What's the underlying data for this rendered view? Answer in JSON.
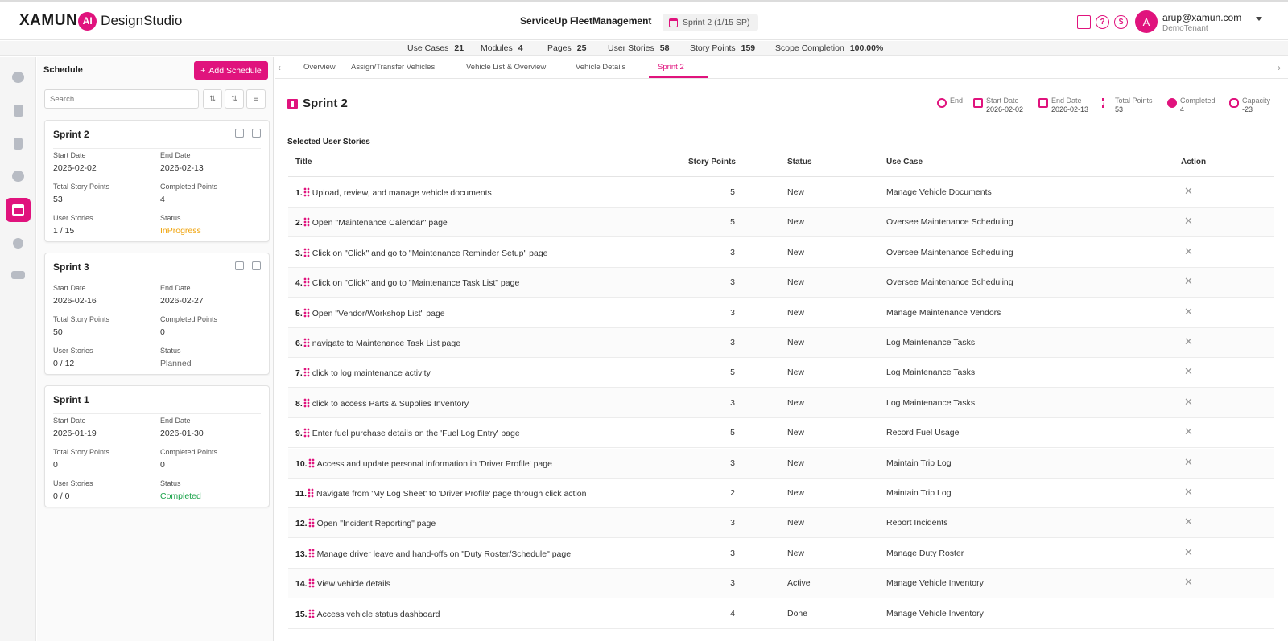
{
  "header": {
    "logo_text": "XAMUN",
    "logo_ai": "AI",
    "logo_suffix": "DesignStudio",
    "project_name": "ServiceUp FleetManagement",
    "sprint_pill": "Sprint 2  (1/15 SP)",
    "icons": [
      "presentation-icon",
      "help-icon",
      "dollar-icon"
    ],
    "avatar_letter": "A",
    "user_email": "arup@xamun.com",
    "tenant": "DemoTenant"
  },
  "stats": [
    {
      "label": "Use Cases",
      "value": "21"
    },
    {
      "label": "Modules",
      "value": "4"
    },
    {
      "label": "Pages",
      "value": "25"
    },
    {
      "label": "User Stories",
      "value": "58"
    },
    {
      "label": "Story Points",
      "value": "159"
    },
    {
      "label": "Scope Completion",
      "value": "100.00%"
    }
  ],
  "rail": [
    "chat-icon",
    "building-icon",
    "document-icon",
    "palette-icon",
    "calendar-icon",
    "gear-icon",
    "handshake-icon"
  ],
  "schedule": {
    "title": "Schedule",
    "add_label": "Add Schedule",
    "search_placeholder": "Search...",
    "labels": {
      "start": "Start Date",
      "end": "End Date",
      "total": "Total Story Points",
      "completed": "Completed Points",
      "stories": "User Stories",
      "status": "Status"
    },
    "sprints": [
      {
        "name": "Sprint 2",
        "start": "2026-02-02",
        "end": "2026-02-13",
        "total": "53",
        "completed": "4",
        "stories": "1 / 15",
        "status": "InProgress"
      },
      {
        "name": "Sprint 3",
        "start": "2026-02-16",
        "end": "2026-02-27",
        "total": "50",
        "completed": "0",
        "stories": "0 / 12",
        "status": "Planned"
      },
      {
        "name": "Sprint 1",
        "start": "2026-01-19",
        "end": "2026-01-30",
        "total": "0",
        "completed": "0",
        "stories": "0 / 0",
        "status": "Completed"
      }
    ]
  },
  "tabs": [
    "Overview",
    "Assign/Transfer Vehicles",
    "Vehicle List & Overview",
    "Vehicle Details",
    "Sprint 2"
  ],
  "sprint": {
    "title": "Sprint 2",
    "metrics": [
      {
        "label": "End",
        "value": ""
      },
      {
        "label": "Start Date",
        "value": "2026-02-02"
      },
      {
        "label": "End Date",
        "value": "2026-02-13"
      },
      {
        "label": "Total Points",
        "value": "53"
      },
      {
        "label": "Completed",
        "value": "4"
      },
      {
        "label": "Capacity",
        "value": "-23"
      }
    ],
    "section_title": "Selected User Stories",
    "columns": [
      "Title",
      "Story Points",
      "Status",
      "Use Case",
      "Action"
    ],
    "rows": [
      {
        "n": "1.",
        "title": "Upload, review, and manage vehicle documents",
        "sp": "5",
        "status": "New",
        "use_case": "Manage Vehicle Documents"
      },
      {
        "n": "2.",
        "title": "Open \"Maintenance Calendar\" page",
        "sp": "5",
        "status": "New",
        "use_case": "Oversee Maintenance Scheduling"
      },
      {
        "n": "3.",
        "title": "Click on \"Click\" and go to \"Maintenance Reminder Setup\" page",
        "sp": "3",
        "status": "New",
        "use_case": "Oversee Maintenance Scheduling"
      },
      {
        "n": "4.",
        "title": "Click on \"Click\" and go to \"Maintenance Task List\" page",
        "sp": "3",
        "status": "New",
        "use_case": "Oversee Maintenance Scheduling"
      },
      {
        "n": "5.",
        "title": "Open \"Vendor/Workshop List\" page",
        "sp": "3",
        "status": "New",
        "use_case": "Manage Maintenance Vendors"
      },
      {
        "n": "6.",
        "title": "navigate to Maintenance Task List page",
        "sp": "3",
        "status": "New",
        "use_case": "Log Maintenance Tasks"
      },
      {
        "n": "7.",
        "title": "click to log maintenance activity",
        "sp": "5",
        "status": "New",
        "use_case": "Log Maintenance Tasks"
      },
      {
        "n": "8.",
        "title": "click to access Parts & Supplies Inventory",
        "sp": "3",
        "status": "New",
        "use_case": "Log Maintenance Tasks"
      },
      {
        "n": "9.",
        "title": "Enter fuel purchase details on the 'Fuel Log Entry' page",
        "sp": "5",
        "status": "New",
        "use_case": "Record Fuel Usage"
      },
      {
        "n": "10.",
        "title": "Access and update personal information in 'Driver Profile' page",
        "sp": "3",
        "status": "New",
        "use_case": "Maintain Trip Log"
      },
      {
        "n": "11.",
        "title": "Navigate from 'My Log Sheet' to 'Driver Profile' page through click action",
        "sp": "2",
        "status": "New",
        "use_case": "Maintain Trip Log"
      },
      {
        "n": "12.",
        "title": "Open \"Incident Reporting\" page",
        "sp": "3",
        "status": "New",
        "use_case": "Report Incidents"
      },
      {
        "n": "13.",
        "title": "Manage driver leave and hand-offs on \"Duty Roster/Schedule\" page",
        "sp": "3",
        "status": "New",
        "use_case": "Manage Duty Roster"
      },
      {
        "n": "14.",
        "title": "View vehicle details",
        "sp": "3",
        "status": "Active",
        "use_case": "Manage Vehicle Inventory"
      },
      {
        "n": "15.",
        "title": "Access vehicle status dashboard",
        "sp": "4",
        "status": "Done",
        "use_case": "Manage Vehicle Inventory"
      }
    ]
  }
}
